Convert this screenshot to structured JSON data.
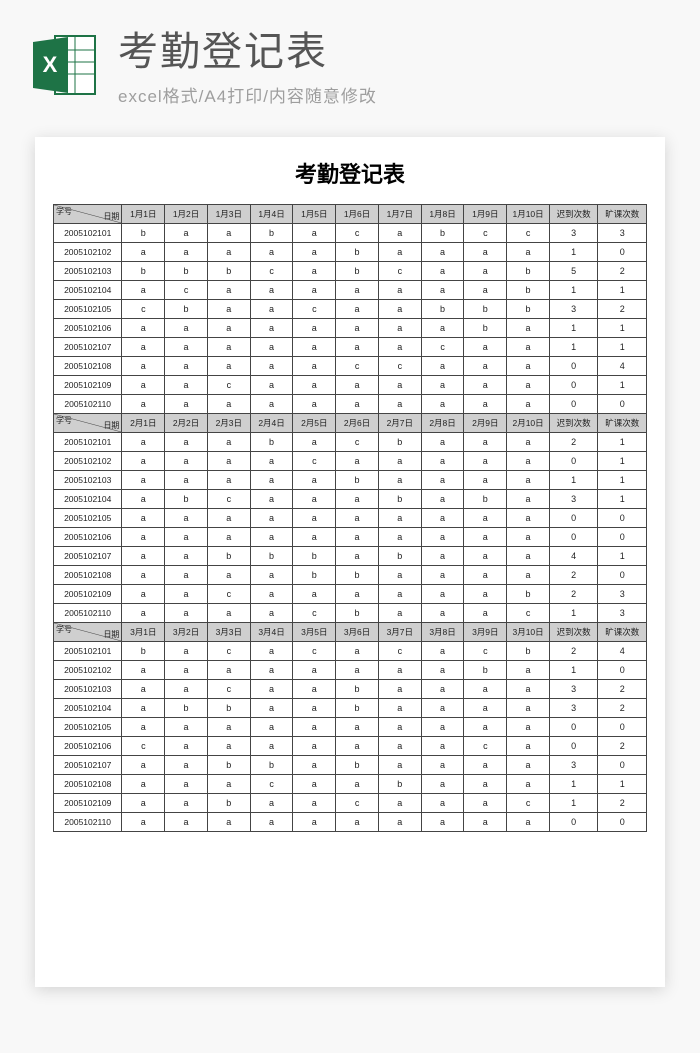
{
  "header": {
    "title": "考勤登记表",
    "subtitle": "excel格式/A4打印/内容随意修改"
  },
  "sheet_title": "考勤登记表",
  "diag_labels": {
    "tl": "学号",
    "br": "日期"
  },
  "col_late": "迟到次数",
  "col_absent": "旷课次数",
  "sections": [
    {
      "dates": [
        "1月1日",
        "1月2日",
        "1月3日",
        "1月4日",
        "1月5日",
        "1月6日",
        "1月7日",
        "1月8日",
        "1月9日",
        "1月10日"
      ],
      "rows": [
        {
          "id": "2005102101",
          "v": [
            "b",
            "a",
            "a",
            "b",
            "a",
            "c",
            "a",
            "b",
            "c",
            "c"
          ],
          "late": "3",
          "abs": "3"
        },
        {
          "id": "2005102102",
          "v": [
            "a",
            "a",
            "a",
            "a",
            "a",
            "b",
            "a",
            "a",
            "a",
            "a"
          ],
          "late": "1",
          "abs": "0"
        },
        {
          "id": "2005102103",
          "v": [
            "b",
            "b",
            "b",
            "c",
            "a",
            "b",
            "c",
            "a",
            "a",
            "b"
          ],
          "late": "5",
          "abs": "2"
        },
        {
          "id": "2005102104",
          "v": [
            "a",
            "c",
            "a",
            "a",
            "a",
            "a",
            "a",
            "a",
            "a",
            "b"
          ],
          "late": "1",
          "abs": "1"
        },
        {
          "id": "2005102105",
          "v": [
            "c",
            "b",
            "a",
            "a",
            "c",
            "a",
            "a",
            "b",
            "b",
            "b"
          ],
          "late": "3",
          "abs": "2"
        },
        {
          "id": "2005102106",
          "v": [
            "a",
            "a",
            "a",
            "a",
            "a",
            "a",
            "a",
            "a",
            "b",
            "a"
          ],
          "late": "1",
          "abs": "1"
        },
        {
          "id": "2005102107",
          "v": [
            "a",
            "a",
            "a",
            "a",
            "a",
            "a",
            "a",
            "c",
            "a",
            "a"
          ],
          "late": "1",
          "abs": "1"
        },
        {
          "id": "2005102108",
          "v": [
            "a",
            "a",
            "a",
            "a",
            "a",
            "c",
            "c",
            "a",
            "a",
            "a"
          ],
          "late": "0",
          "abs": "4"
        },
        {
          "id": "2005102109",
          "v": [
            "a",
            "a",
            "c",
            "a",
            "a",
            "a",
            "a",
            "a",
            "a",
            "a"
          ],
          "late": "0",
          "abs": "1"
        },
        {
          "id": "2005102110",
          "v": [
            "a",
            "a",
            "a",
            "a",
            "a",
            "a",
            "a",
            "a",
            "a",
            "a"
          ],
          "late": "0",
          "abs": "0"
        }
      ]
    },
    {
      "dates": [
        "2月1日",
        "2月2日",
        "2月3日",
        "2月4日",
        "2月5日",
        "2月6日",
        "2月7日",
        "2月8日",
        "2月9日",
        "2月10日"
      ],
      "rows": [
        {
          "id": "2005102101",
          "v": [
            "a",
            "a",
            "a",
            "b",
            "a",
            "c",
            "b",
            "a",
            "a",
            "a"
          ],
          "late": "2",
          "abs": "1"
        },
        {
          "id": "2005102102",
          "v": [
            "a",
            "a",
            "a",
            "a",
            "c",
            "a",
            "a",
            "a",
            "a",
            "a"
          ],
          "late": "0",
          "abs": "1"
        },
        {
          "id": "2005102103",
          "v": [
            "a",
            "a",
            "a",
            "a",
            "a",
            "b",
            "a",
            "a",
            "a",
            "a"
          ],
          "late": "1",
          "abs": "1"
        },
        {
          "id": "2005102104",
          "v": [
            "a",
            "b",
            "c",
            "a",
            "a",
            "a",
            "b",
            "a",
            "b",
            "a"
          ],
          "late": "3",
          "abs": "1"
        },
        {
          "id": "2005102105",
          "v": [
            "a",
            "a",
            "a",
            "a",
            "a",
            "a",
            "a",
            "a",
            "a",
            "a"
          ],
          "late": "0",
          "abs": "0"
        },
        {
          "id": "2005102106",
          "v": [
            "a",
            "a",
            "a",
            "a",
            "a",
            "a",
            "a",
            "a",
            "a",
            "a"
          ],
          "late": "0",
          "abs": "0"
        },
        {
          "id": "2005102107",
          "v": [
            "a",
            "a",
            "b",
            "b",
            "b",
            "a",
            "b",
            "a",
            "a",
            "a"
          ],
          "late": "4",
          "abs": "1"
        },
        {
          "id": "2005102108",
          "v": [
            "a",
            "a",
            "a",
            "a",
            "b",
            "b",
            "a",
            "a",
            "a",
            "a"
          ],
          "late": "2",
          "abs": "0"
        },
        {
          "id": "2005102109",
          "v": [
            "a",
            "a",
            "c",
            "a",
            "a",
            "a",
            "a",
            "a",
            "a",
            "b"
          ],
          "late": "2",
          "abs": "3"
        },
        {
          "id": "2005102110",
          "v": [
            "a",
            "a",
            "a",
            "a",
            "c",
            "b",
            "a",
            "a",
            "a",
            "c"
          ],
          "late": "1",
          "abs": "3"
        }
      ]
    },
    {
      "dates": [
        "3月1日",
        "3月2日",
        "3月3日",
        "3月4日",
        "3月5日",
        "3月6日",
        "3月7日",
        "3月8日",
        "3月9日",
        "3月10日"
      ],
      "rows": [
        {
          "id": "2005102101",
          "v": [
            "b",
            "a",
            "c",
            "a",
            "c",
            "a",
            "c",
            "a",
            "c",
            "b"
          ],
          "late": "2",
          "abs": "4"
        },
        {
          "id": "2005102102",
          "v": [
            "a",
            "a",
            "a",
            "a",
            "a",
            "a",
            "a",
            "a",
            "b",
            "a"
          ],
          "late": "1",
          "abs": "0"
        },
        {
          "id": "2005102103",
          "v": [
            "a",
            "a",
            "c",
            "a",
            "a",
            "b",
            "a",
            "a",
            "a",
            "a"
          ],
          "late": "3",
          "abs": "2"
        },
        {
          "id": "2005102104",
          "v": [
            "a",
            "b",
            "b",
            "a",
            "a",
            "b",
            "a",
            "a",
            "a",
            "a"
          ],
          "late": "3",
          "abs": "2"
        },
        {
          "id": "2005102105",
          "v": [
            "a",
            "a",
            "a",
            "a",
            "a",
            "a",
            "a",
            "a",
            "a",
            "a"
          ],
          "late": "0",
          "abs": "0"
        },
        {
          "id": "2005102106",
          "v": [
            "c",
            "a",
            "a",
            "a",
            "a",
            "a",
            "a",
            "a",
            "c",
            "a"
          ],
          "late": "0",
          "abs": "2"
        },
        {
          "id": "2005102107",
          "v": [
            "a",
            "a",
            "b",
            "b",
            "a",
            "b",
            "a",
            "a",
            "a",
            "a"
          ],
          "late": "3",
          "abs": "0"
        },
        {
          "id": "2005102108",
          "v": [
            "a",
            "a",
            "a",
            "c",
            "a",
            "a",
            "b",
            "a",
            "a",
            "a"
          ],
          "late": "1",
          "abs": "1"
        },
        {
          "id": "2005102109",
          "v": [
            "a",
            "a",
            "b",
            "a",
            "a",
            "c",
            "a",
            "a",
            "a",
            "c"
          ],
          "late": "1",
          "abs": "2"
        },
        {
          "id": "2005102110",
          "v": [
            "a",
            "a",
            "a",
            "a",
            "a",
            "a",
            "a",
            "a",
            "a",
            "a"
          ],
          "late": "0",
          "abs": "0"
        }
      ]
    }
  ]
}
